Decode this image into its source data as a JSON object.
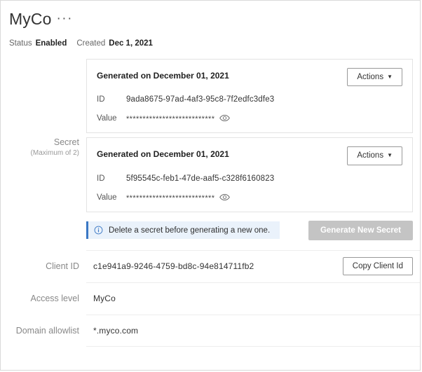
{
  "header": {
    "title": "MyCo",
    "ellipsis": "···",
    "status_label": "Status",
    "status_value": "Enabled",
    "created_label": "Created",
    "created_value": "Dec 1, 2021"
  },
  "secret_section": {
    "label": "Secret",
    "sub_label": "(Maximum of 2)",
    "cards": [
      {
        "generated_on": "Generated on December 01, 2021",
        "actions_label": "Actions",
        "id_label": "ID",
        "id_value": "9ada8675-97ad-4af3-95c8-7f2edfc3dfe3",
        "value_label": "Value",
        "value_masked": "***************************"
      },
      {
        "generated_on": "Generated on December 01, 2021",
        "actions_label": "Actions",
        "id_label": "ID",
        "id_value": "5f95545c-feb1-47de-aaf5-c328f6160823",
        "value_label": "Value",
        "value_masked": "***************************"
      }
    ],
    "notice_text": "Delete a secret before generating a new one.",
    "generate_button": "Generate New Secret"
  },
  "rows": {
    "client_id": {
      "label": "Client ID",
      "value": "c1e941a9-9246-4759-bd8c-94e814711fb2",
      "button": "Copy Client Id"
    },
    "access_level": {
      "label": "Access level",
      "value": "MyCo"
    },
    "domain_allowlist": {
      "label": "Domain allowlist",
      "value": "*.myco.com"
    }
  },
  "colors": {
    "accent_blue": "#3a77c4",
    "notice_bg": "#eaf2fb",
    "disabled_gray": "#c4c4c4",
    "border": "#e3e3e3"
  }
}
